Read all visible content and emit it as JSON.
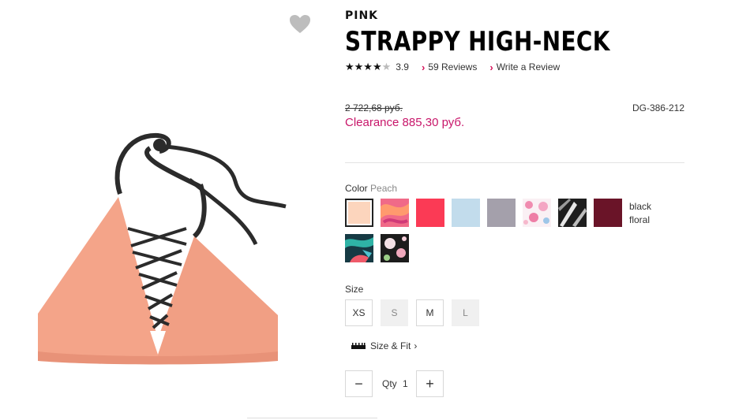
{
  "product": {
    "brand": "PINK",
    "title": "STRAPPY HIGH-NECK",
    "rating": "3.9",
    "reviews_link": "59 Reviews",
    "write_review_link": "Write a Review",
    "old_price": "2 722,68 руб.",
    "sale_price": "Clearance 885,30 руб.",
    "sku": "DG-386-212"
  },
  "color": {
    "label": "Color",
    "selected": "Peach",
    "swatches": [
      {
        "name": "peach",
        "color": "#fcd5bd"
      },
      {
        "name": "pink-print",
        "color": "#f05a78"
      },
      {
        "name": "coral-red",
        "color": "#fb3a55"
      },
      {
        "name": "light-blue",
        "color": "#c2dcec"
      },
      {
        "name": "gray",
        "color": "#a4a0ab"
      },
      {
        "name": "white-floral",
        "color": "#f3c8d8"
      },
      {
        "name": "black-palm",
        "color": "#2a2a2a"
      },
      {
        "name": "burgundy",
        "color": "#6a1428"
      },
      {
        "name": "teal-tropical",
        "color": "#1d5a64"
      },
      {
        "name": "black-floral",
        "color": "#1c1c1c"
      }
    ],
    "note": [
      "black",
      "floral"
    ]
  },
  "size": {
    "label": "Size",
    "options": [
      {
        "label": "XS",
        "available": true
      },
      {
        "label": "S",
        "available": false
      },
      {
        "label": "M",
        "available": true
      },
      {
        "label": "L",
        "available": false
      }
    ],
    "fit_link": "Size & Fit"
  },
  "quantity": {
    "minus": "−",
    "label": "Qty",
    "value": "1",
    "plus": "+"
  },
  "icons": {
    "favorite": "heart-icon",
    "chevron": "chevron-right-icon",
    "ruler": "ruler-icon"
  },
  "colors": {
    "accent": "#c8166a",
    "bikini": "#f4a489",
    "strap": "#2b2b2b"
  }
}
